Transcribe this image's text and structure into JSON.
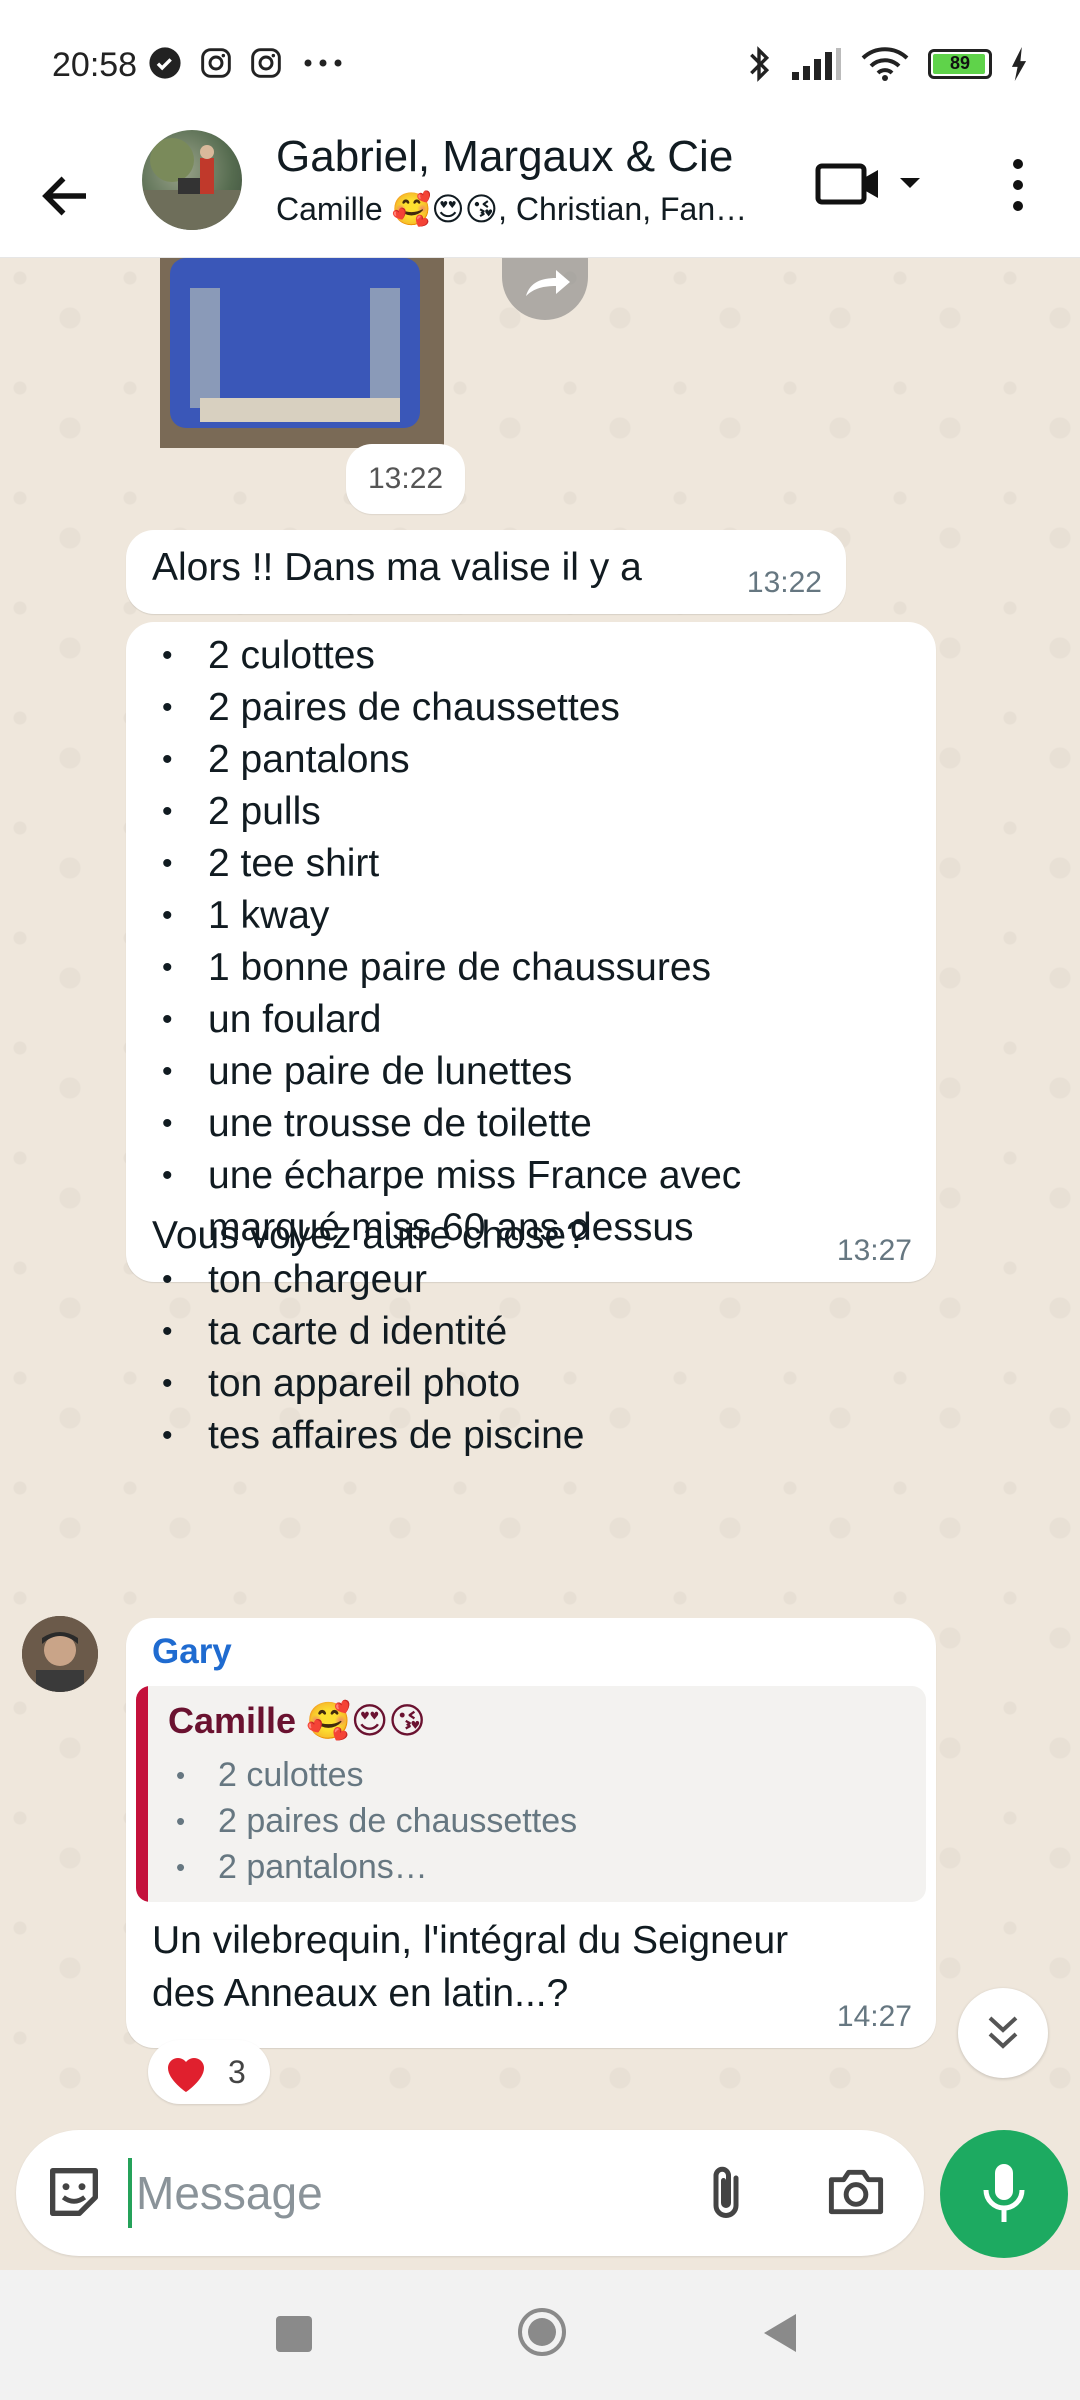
{
  "status_bar": {
    "time": "20:58",
    "battery": "89"
  },
  "header": {
    "title": "Gabriel, Margaux & Cie",
    "subtitle": "Camille 🥰😍😘, Christian, Fan…"
  },
  "chat": {
    "image_time": "13:22",
    "messages": [
      {
        "text": "Alors !! Dans ma valise il y a",
        "time": "13:22"
      },
      {
        "items": [
          "2 culottes",
          "2 paires de chaussettes",
          "2 pantalons",
          "2 pulls",
          "2 tee shirt",
          "1 kway",
          "1 bonne paire de chaussures",
          "un foulard",
          "une paire de lunettes",
          "une trousse de toilette",
          "une écharpe miss France avec marqué miss 60 ans dessus",
          "ton chargeur",
          "ta carte d identité",
          "ton appareil photo",
          "tes affaires de piscine"
        ],
        "question": "Vous voyez autre chose?",
        "time": "13:27"
      },
      {
        "sender": "Gary",
        "quote": {
          "name": "Camille 🥰😍😘",
          "items": [
            "2 culottes",
            "2 paires de chaussettes",
            "2 pantalons…"
          ]
        },
        "text": "Un vilebrequin, l'intégral du Seigneur des Anneaux en latin...?",
        "time": "14:27",
        "reaction": {
          "emoji": "heart",
          "count": "3"
        }
      }
    ]
  },
  "input": {
    "placeholder": "Message"
  },
  "colors": {
    "accent_green": "#1daa61",
    "sender_blue": "#1f6bd0",
    "quote_bar": "#c4113c",
    "chat_bg": "#efe7dc"
  },
  "icons": [
    "back-arrow-icon",
    "video-call-icon",
    "more-vert-icon",
    "forward-icon",
    "heart-icon",
    "chevron-double-down-icon",
    "sticker-icon",
    "paperclip-icon",
    "camera-icon",
    "microphone-icon"
  ]
}
